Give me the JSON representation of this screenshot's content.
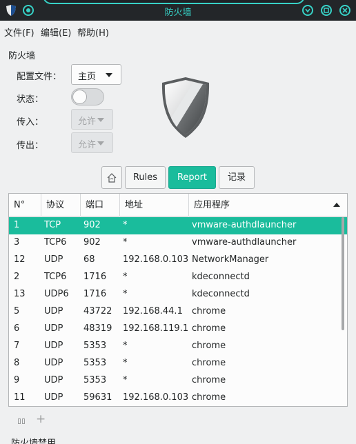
{
  "window": {
    "title": "防火墙"
  },
  "menu": [
    "文件(F)",
    "编辑(E)",
    "帮助(H)"
  ],
  "group_label": "防火墙",
  "form": {
    "profile_label": "配置文件：",
    "profile_value": "主页",
    "status_label": "状态：",
    "status_on": false,
    "incoming_label": "传入：",
    "incoming_value": "允许",
    "outgoing_label": "传出：",
    "outgoing_value": "允许"
  },
  "toolbar": {
    "home_icon": "home-icon",
    "rules_label": "Rules",
    "report_label": "Report",
    "log_label": "记录"
  },
  "table": {
    "columns": [
      "N°",
      "协议",
      "端口",
      "地址",
      "应用程序"
    ],
    "rows": [
      {
        "no": "1",
        "proto": "TCP",
        "port": "902",
        "addr": "*",
        "app": "vmware-authdlauncher"
      },
      {
        "no": "3",
        "proto": "TCP6",
        "port": "902",
        "addr": "*",
        "app": "vmware-authdlauncher"
      },
      {
        "no": "12",
        "proto": "UDP",
        "port": "68",
        "addr": "192.168.0.103",
        "app": "NetworkManager"
      },
      {
        "no": "2",
        "proto": "TCP6",
        "port": "1716",
        "addr": "*",
        "app": "kdeconnectd"
      },
      {
        "no": "13",
        "proto": "UDP6",
        "port": "1716",
        "addr": "*",
        "app": "kdeconnectd"
      },
      {
        "no": "5",
        "proto": "UDP",
        "port": "43722",
        "addr": "192.168.44.1",
        "app": "chrome"
      },
      {
        "no": "6",
        "proto": "UDP",
        "port": "48319",
        "addr": "192.168.119.1",
        "app": "chrome"
      },
      {
        "no": "7",
        "proto": "UDP",
        "port": "5353",
        "addr": "*",
        "app": "chrome"
      },
      {
        "no": "8",
        "proto": "UDP",
        "port": "5353",
        "addr": "*",
        "app": "chrome"
      },
      {
        "no": "9",
        "proto": "UDP",
        "port": "5353",
        "addr": "*",
        "app": "chrome"
      },
      {
        "no": "11",
        "proto": "UDP",
        "port": "59631",
        "addr": "192.168.0.103",
        "app": "chrome"
      }
    ]
  },
  "bottom_label": "防火墙禁用",
  "colors": {
    "accent": "#1abc9c",
    "titlebar": "#232629",
    "title_text": "#37d2c7"
  }
}
